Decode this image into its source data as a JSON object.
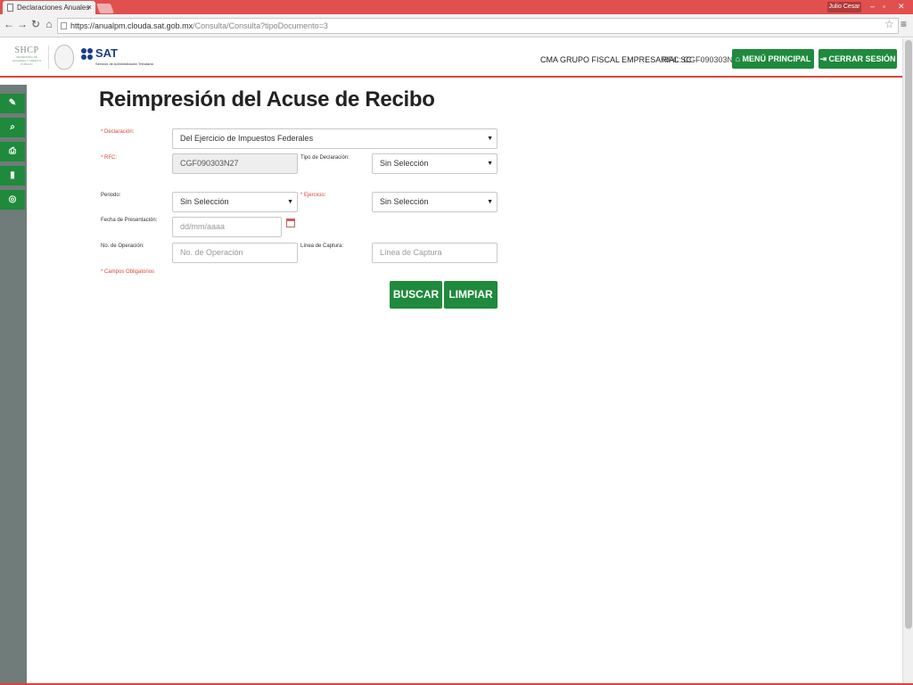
{
  "browser": {
    "tab_title": "Declaraciones Anuales",
    "tab_close": "×",
    "user_badge": "Julio Cesar",
    "url_host": "https://anualpm.clouda.sat.gob.mx",
    "url_path": "/Consulta/Consulta?tipoDocumento=3"
  },
  "header": {
    "shcp_logo_text": "SHCP",
    "shcp_logo_sub": "SECRETARÍA DE HACIENDA Y CRÉDITO PÚBLICO",
    "sat_logo_text": "SAT",
    "sat_logo_sub": "Servicio de Administración Tributaria",
    "company": "CMA GRUPO FISCAL EMPRESARIAL SC",
    "rfc": "RFC: CGF090303N27",
    "menu_button": "MENÚ PRINCIPAL",
    "logout_button": "CERRAR SESIÓN"
  },
  "page": {
    "title": "Reimpresión del Acuse de Recibo"
  },
  "form": {
    "declaracion_label": "* Declaración:",
    "declaracion_value": "Del Ejercicio de Impuestos Federales",
    "rfc_label": "* RFC:",
    "rfc_value": "CGF090303N27",
    "tipo_label": "Tipo de Declaración:",
    "tipo_value": "Sin Selección",
    "periodo_label": "Periodo:",
    "periodo_value": "Sin Selección",
    "ejercicio_label": "* Ejercicio:",
    "ejercicio_value": "Sin Selección",
    "fecha_label": "Fecha de Presentación:",
    "fecha_placeholder": "dd/mm/aaaa",
    "operacion_label": "No. de Operación:",
    "operacion_placeholder": "No. de Operación",
    "captura_label": "Línea de Captura:",
    "captura_placeholder": "Línea de Captura",
    "required_note": "* Campos Obligatorios",
    "search_button": "BUSCAR",
    "clear_button": "LIMPIAR"
  },
  "colors": {
    "brand_green": "#1f8a3c",
    "accent_red": "#d9453a",
    "sidebar_gray": "#6f7c7a"
  }
}
